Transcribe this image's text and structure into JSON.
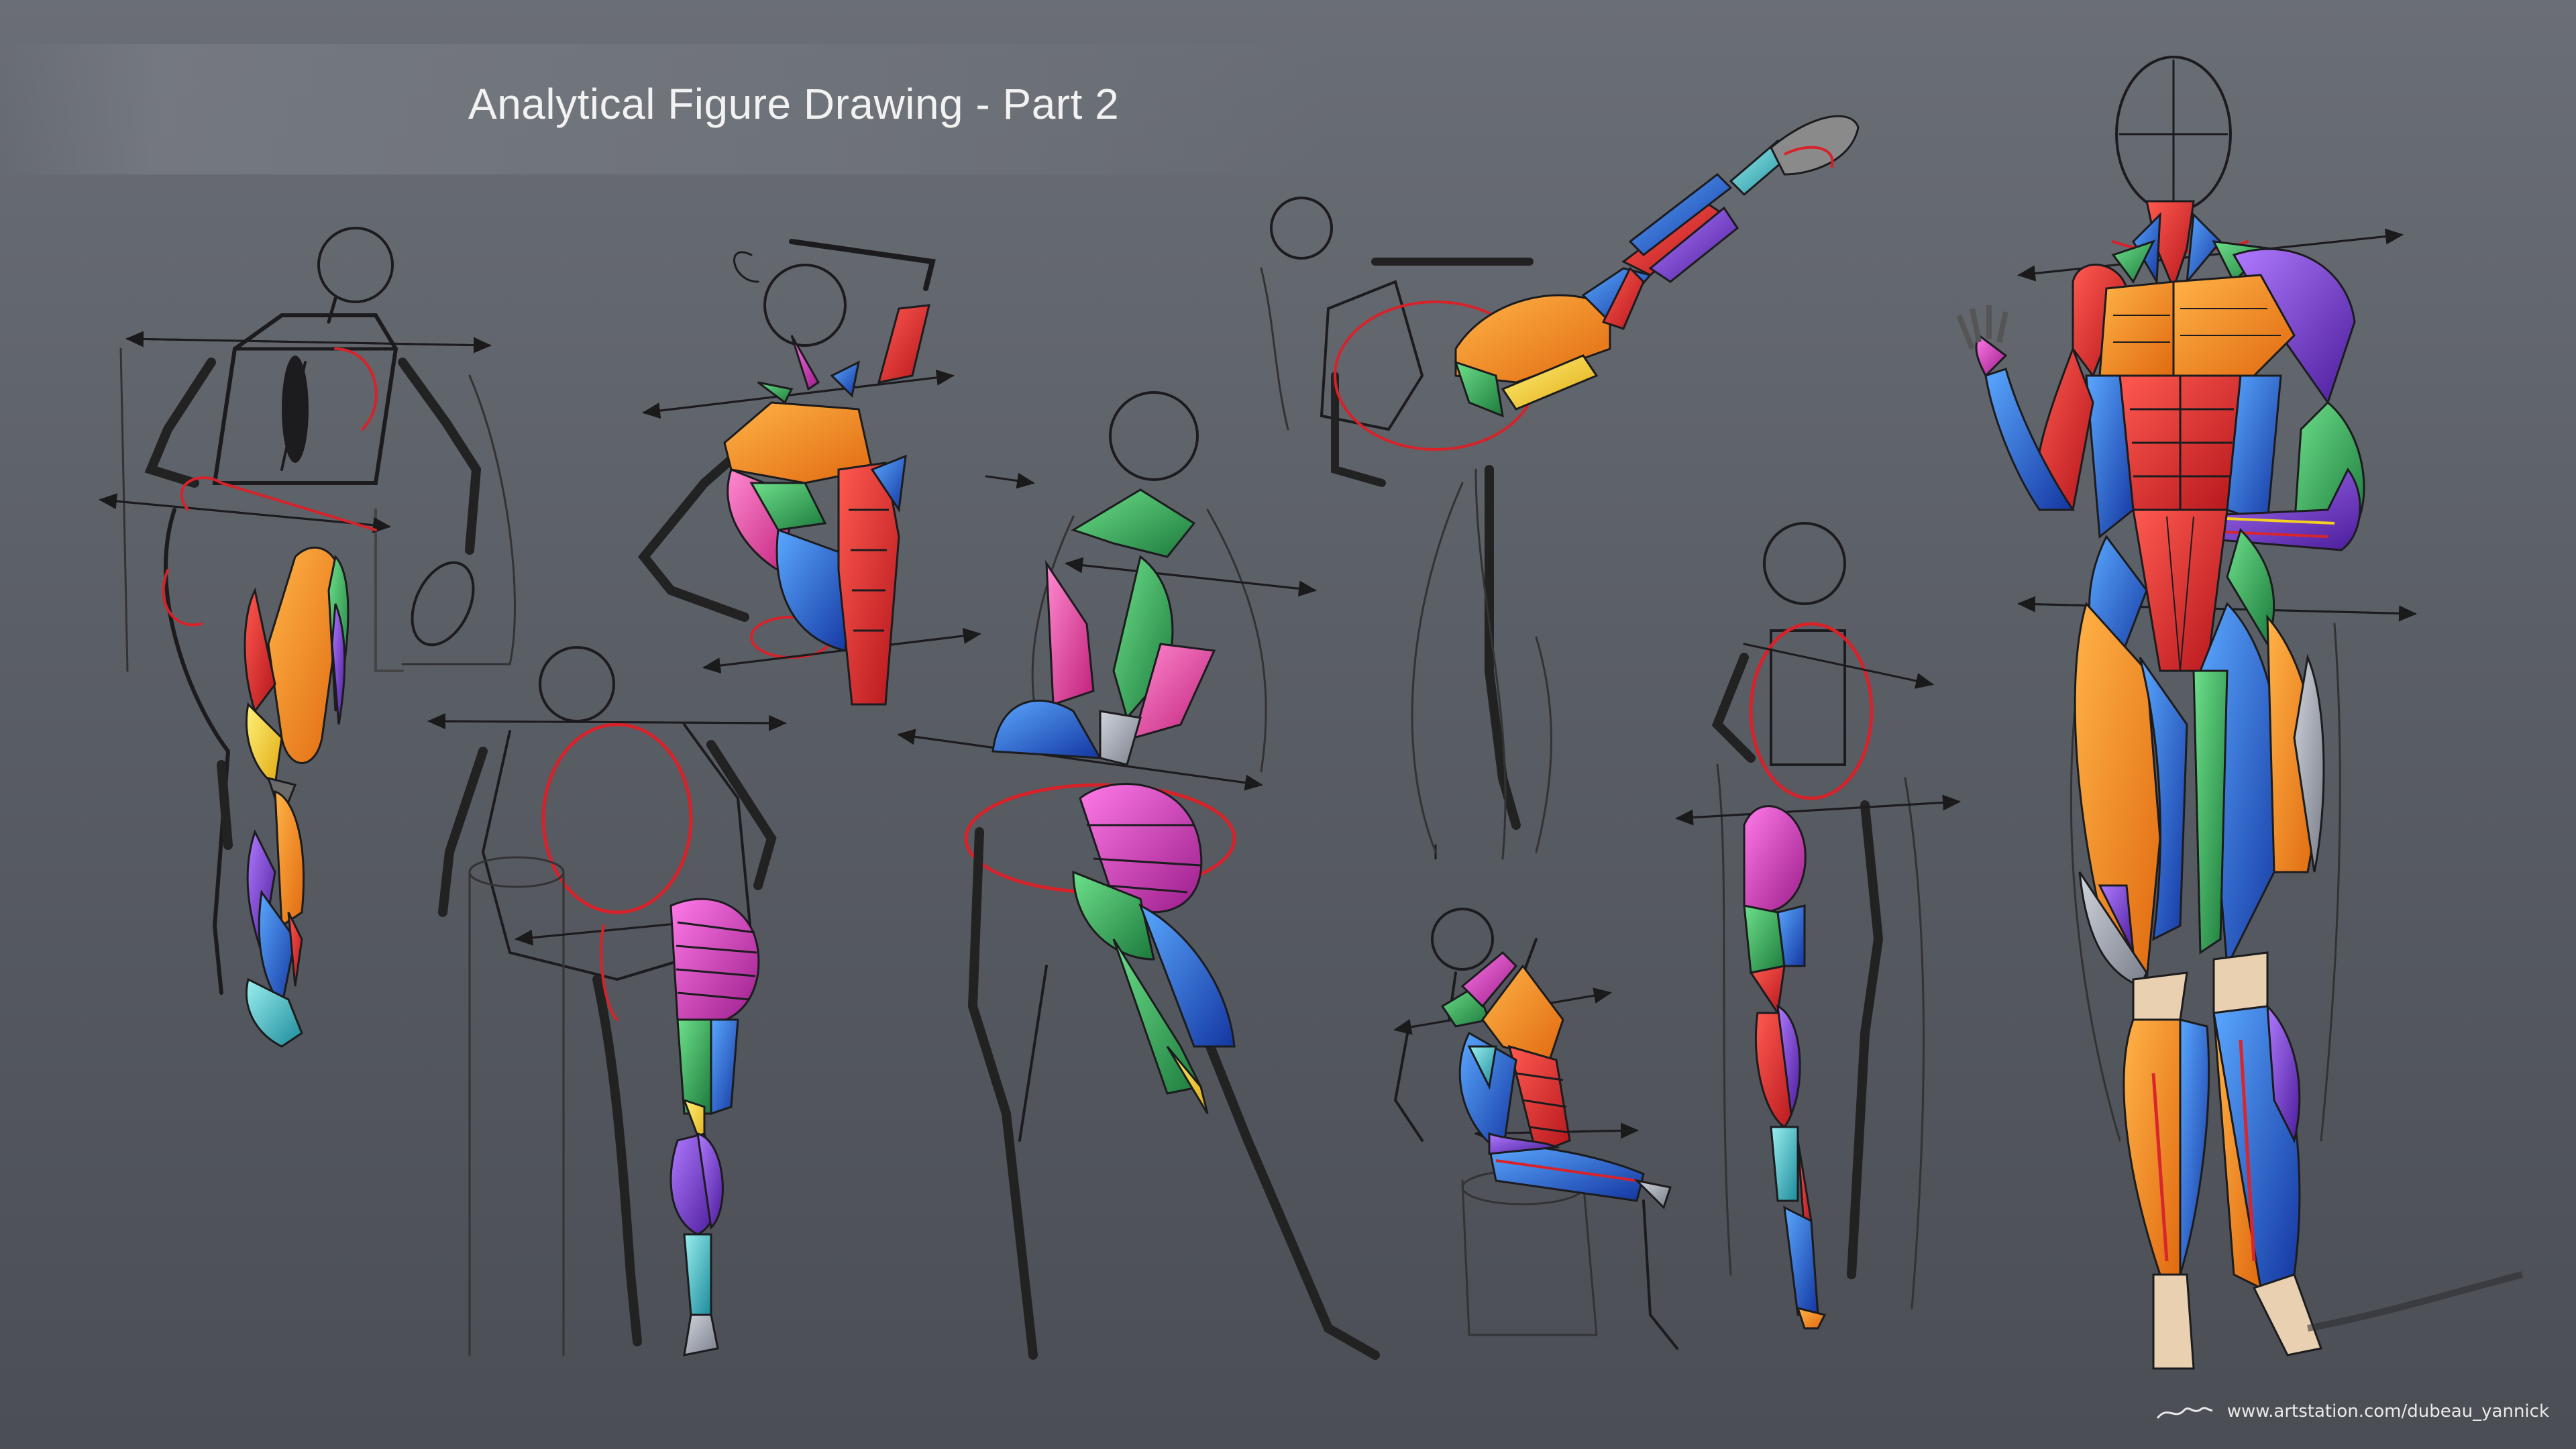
{
  "title": "Analytical Figure Drawing - Part 2",
  "watermark": {
    "url": "www.artstation.com/dubeau_yannick",
    "signature_icon": "signature-icon"
  },
  "palette": {
    "background": "#5a5e65",
    "sketch_line": "#1c1c1f",
    "construction_red": "#d8222a",
    "muscle_orange": "#f08a1c",
    "muscle_red": "#d8262c",
    "muscle_blue": "#1f6fe0",
    "muscle_green": "#2fae5a",
    "muscle_purple": "#7a3ec8",
    "muscle_pink": "#e0409a",
    "muscle_yellow": "#f5d020",
    "muscle_teal": "#3cc0c8",
    "muscle_magenta": "#c83cc0"
  },
  "figures": [
    "figure-standing-leg",
    "figure-back-arm-raised",
    "figure-back-hip",
    "figure-torso-twist",
    "figure-high-kick",
    "figure-seated-crouch",
    "figure-back-turned-leg",
    "figure-front-full-body"
  ]
}
